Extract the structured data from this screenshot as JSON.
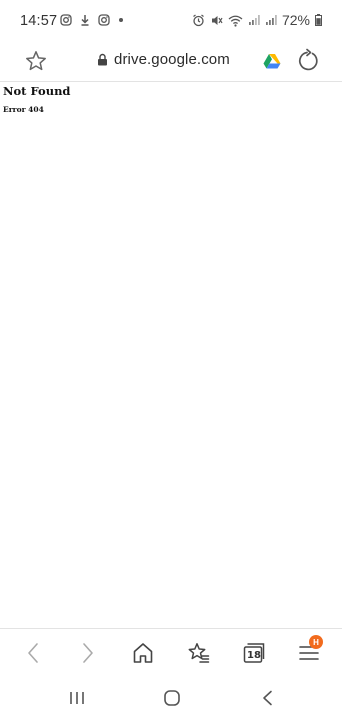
{
  "status_bar": {
    "time": "14:57",
    "left_icons": [
      "instagram-icon",
      "download-icon",
      "instagram-icon",
      "dot-icon"
    ],
    "right_icons": [
      "alarm-icon",
      "mute-icon",
      "wifi-icon",
      "signal-icon",
      "signal-icon",
      "battery-icon"
    ],
    "battery_percent": "72%"
  },
  "address_bar": {
    "url": "drive.google.com",
    "icons": [
      "star-icon",
      "lock-icon",
      "google-drive-icon",
      "reload-icon"
    ]
  },
  "page": {
    "heading": "Not Found",
    "subheading": "Error 404"
  },
  "toolbar": {
    "tab_count": "18",
    "menu_badge": "H",
    "icons": [
      "back-icon",
      "forward-icon",
      "home-icon",
      "bookmarks-icon",
      "tabs-icon",
      "menu-icon"
    ],
    "badge_color": "#f26b1d"
  },
  "system_nav": {
    "icons": [
      "recent-apps-icon",
      "home-button-icon",
      "back-icon"
    ]
  },
  "colors": {
    "background": "#ffffff",
    "text": "#111111",
    "icon": "#555555",
    "drive_green": "#1ea362",
    "drive_yellow": "#ffba00",
    "drive_blue": "#4285f4"
  }
}
